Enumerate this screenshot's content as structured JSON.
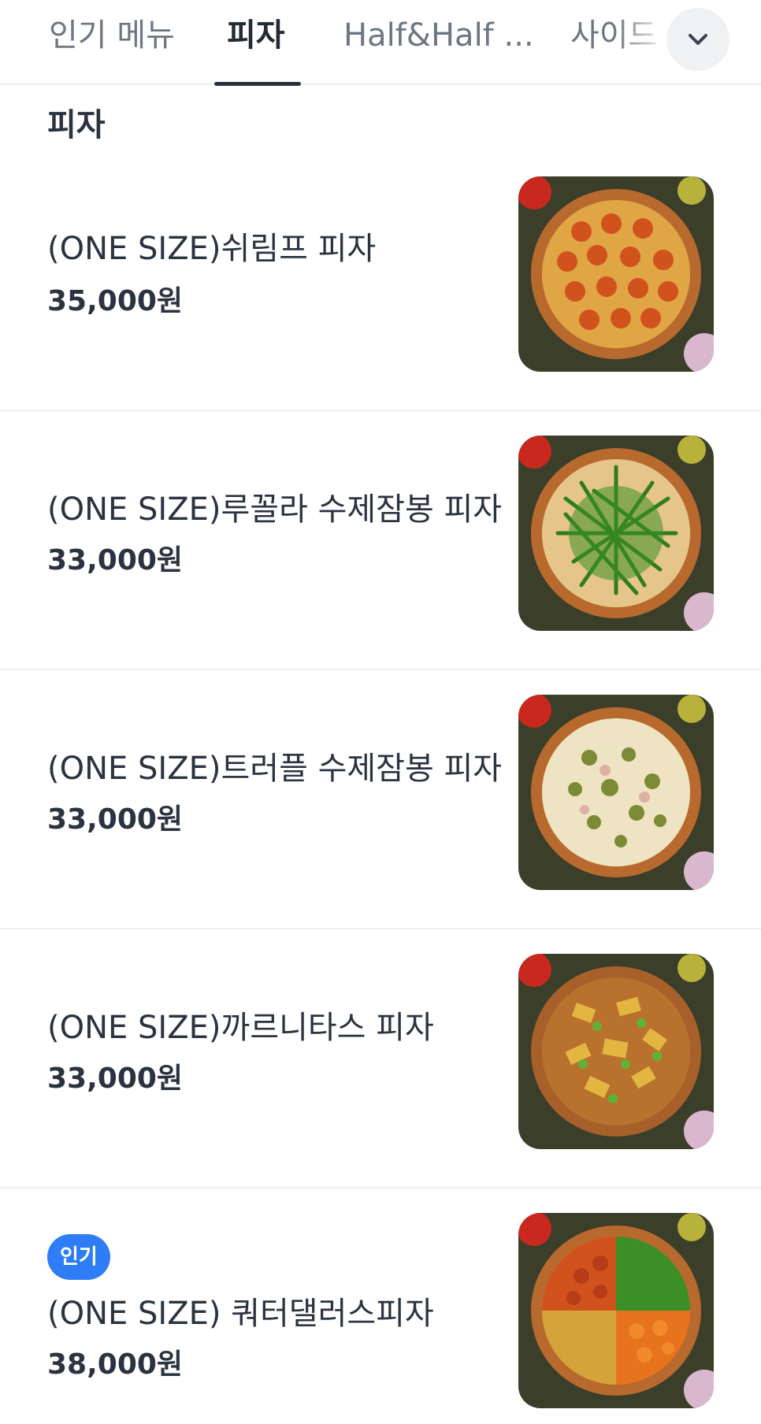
{
  "tabs": [
    {
      "label": "인기 메뉴",
      "active": false
    },
    {
      "label": "피자",
      "active": true
    },
    {
      "label": "Half&Half ...",
      "active": false
    },
    {
      "label": "사이드",
      "active": false
    }
  ],
  "dropdown_icon": "chevron-down-icon",
  "section_title": "피자",
  "items": [
    {
      "name": "(ONE SIZE)쉬림프 피자",
      "price": "35,000원",
      "badge": "",
      "topping": "shrimp"
    },
    {
      "name": "(ONE SIZE)루꼴라 수제잠봉 피자",
      "price": "33,000원",
      "badge": "",
      "topping": "arugula"
    },
    {
      "name": "(ONE SIZE)트러플 수제잠봉 피자",
      "price": "33,000원",
      "badge": "",
      "topping": "truffle"
    },
    {
      "name": "(ONE SIZE)까르니타스 피자",
      "price": "33,000원",
      "badge": "",
      "topping": "carnitas"
    },
    {
      "name": "(ONE SIZE) 쿼터댈러스피자",
      "price": "38,000원",
      "badge": "인기",
      "topping": "quarter"
    }
  ],
  "colors": {
    "accent_badge": "#2f7df6",
    "text_primary": "#2b3340",
    "text_tab_inactive": "#6e7683"
  }
}
